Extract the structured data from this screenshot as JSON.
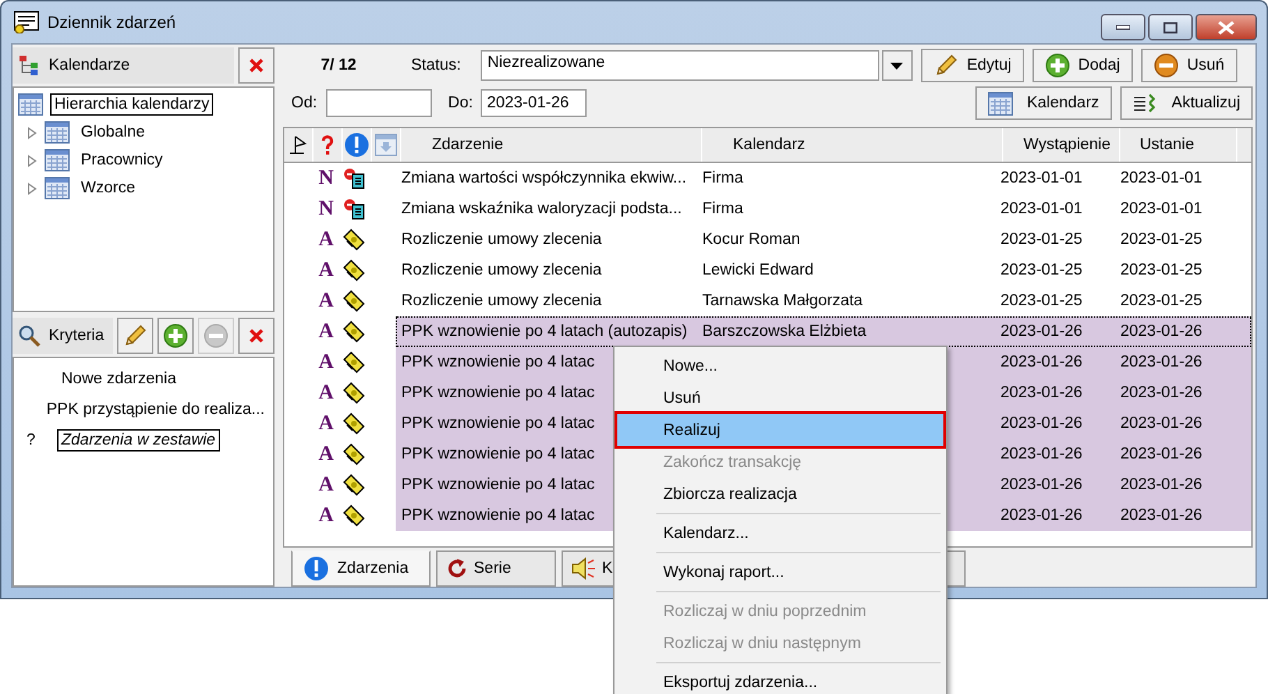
{
  "window": {
    "title": "Dziennik zdarzeń"
  },
  "calendars": {
    "title": "Kalendarze",
    "tree": [
      {
        "label": "Hierarchia kalendarzy",
        "selected": true,
        "children": [
          {
            "label": "Globalne",
            "selected": false,
            "expanded": false
          },
          {
            "label": "Pracownicy",
            "selected": false,
            "expanded": false
          },
          {
            "label": "Wzorce",
            "selected": false,
            "expanded": false
          }
        ]
      }
    ]
  },
  "criteria": {
    "title": "Kryteria",
    "tools": [
      {
        "kind": "edit",
        "disabled": false
      },
      {
        "kind": "add",
        "disabled": false
      },
      {
        "kind": "remove",
        "disabled": true
      },
      {
        "kind": "close",
        "disabled": false
      }
    ],
    "items": [
      {
        "label": "Nowe zdarzenia",
        "marker": "",
        "selected": false,
        "italic": false
      },
      {
        "label": "PPK przystąpienie do realiza...",
        "selected": false,
        "italic": false
      },
      {
        "label": "Zdarzenia w zestawie",
        "marker": "?",
        "selected": true,
        "italic": true
      }
    ]
  },
  "toolbar": {
    "counter": "7/ 12",
    "status_label": "Status:",
    "status_value": "Niezrealizowane",
    "from_label": "Od:",
    "to_label": "Do:",
    "to_value": "2023-01-26",
    "buttons": [
      {
        "kind": "edit",
        "label": "Edytuj"
      },
      {
        "kind": "add",
        "label": "Dodaj"
      },
      {
        "kind": "remove",
        "label": "Usuń"
      }
    ],
    "buttons_2": [
      {
        "kind": "calendar",
        "label": "Kalendarz"
      },
      {
        "kind": "refresh",
        "label": "Aktualizuj"
      }
    ]
  },
  "table": {
    "columns": [
      "Zdarzenie",
      "Kalendarz",
      "Wystąpienie",
      "Ustanie"
    ],
    "rows": [
      {
        "type": "N",
        "kind": "change",
        "event": "Zmiana wartości współczynnika ekwiw...",
        "calendar": "Firma",
        "occurrence": "2023-01-01",
        "end": "2023-01-01",
        "selected": false
      },
      {
        "type": "N",
        "kind": "change",
        "event": "Zmiana wskaźnika waloryzacji podsta...",
        "calendar": "Firma",
        "occurrence": "2023-01-01",
        "end": "2023-01-01",
        "selected": false
      },
      {
        "type": "A",
        "kind": "ticket",
        "event": "Rozliczenie umowy zlecenia",
        "calendar": "Kocur Roman",
        "occurrence": "2023-01-25",
        "end": "2023-01-25",
        "selected": false
      },
      {
        "type": "A",
        "kind": "ticket",
        "event": "Rozliczenie umowy zlecenia",
        "calendar": "Lewicki Edward",
        "occurrence": "2023-01-25",
        "end": "2023-01-25",
        "selected": false
      },
      {
        "type": "A",
        "kind": "ticket",
        "event": "Rozliczenie umowy zlecenia",
        "calendar": "Tarnawska Małgorzata",
        "occurrence": "2023-01-25",
        "end": "2023-01-25",
        "selected": false
      },
      {
        "type": "A",
        "kind": "ticket",
        "event": "PPK wznowienie po 4 latach (autozapis)",
        "calendar": "Barszczowska Elżbieta",
        "occurrence": "2023-01-26",
        "end": "2023-01-26",
        "selected": true
      },
      {
        "type": "A",
        "kind": "ticket",
        "event": "PPK wznowienie po 4 latac",
        "occurrence": "2023-01-26",
        "end": "2023-01-26",
        "selected": true
      },
      {
        "type": "A",
        "kind": "ticket",
        "event": "PPK wznowienie po 4 latac",
        "occurrence": "2023-01-26",
        "end": "2023-01-26",
        "selected": true
      },
      {
        "type": "A",
        "kind": "ticket",
        "event": "PPK wznowienie po 4 latac",
        "occurrence": "2023-01-26",
        "end": "2023-01-26",
        "selected": true
      },
      {
        "type": "A",
        "kind": "ticket",
        "event": "PPK wznowienie po 4 latac",
        "occurrence": "2023-01-26",
        "end": "2023-01-26",
        "selected": true
      },
      {
        "type": "A",
        "kind": "ticket",
        "event": "PPK wznowienie po 4 latac",
        "occurrence": "2023-01-26",
        "end": "2023-01-26",
        "selected": true
      },
      {
        "type": "A",
        "kind": "ticket",
        "event": "PPK wznowienie po 4 latac",
        "occurrence": "2023-01-26",
        "end": "2023-01-26",
        "selected": true
      }
    ]
  },
  "bottom_tabs": [
    {
      "kind": "events",
      "label": "Zdarzenia",
      "selected": true
    },
    {
      "kind": "series",
      "label": "Serie",
      "selected": false
    },
    {
      "kind": "sound",
      "label": "K",
      "selected": false
    }
  ],
  "context_menu": {
    "items": [
      {
        "kind": "item",
        "label": "Nowe...",
        "disabled": false,
        "selected": false
      },
      {
        "kind": "item",
        "label": "Usuń",
        "disabled": false,
        "selected": false
      },
      {
        "kind": "item",
        "label": "Realizuj",
        "disabled": false,
        "selected": true
      },
      {
        "kind": "item",
        "label": "Zakończ transakcję",
        "disabled": true,
        "selected": false
      },
      {
        "kind": "item",
        "label": "Zbiorcza realizacja",
        "disabled": false,
        "selected": false
      },
      {
        "kind": "separator"
      },
      {
        "kind": "item",
        "label": "Kalendarz...",
        "disabled": false,
        "selected": false
      },
      {
        "kind": "separator"
      },
      {
        "kind": "item",
        "label": "Wykonaj raport...",
        "disabled": false,
        "selected": false
      },
      {
        "kind": "separator"
      },
      {
        "kind": "item",
        "label": "Rozliczaj w dniu poprzednim",
        "disabled": true,
        "selected": false
      },
      {
        "kind": "item",
        "label": "Rozliczaj w dniu następnym",
        "disabled": true,
        "selected": false
      },
      {
        "kind": "separator"
      },
      {
        "kind": "item",
        "label": "Eksportuj zdarzenia...",
        "disabled": false,
        "selected": false
      }
    ]
  }
}
